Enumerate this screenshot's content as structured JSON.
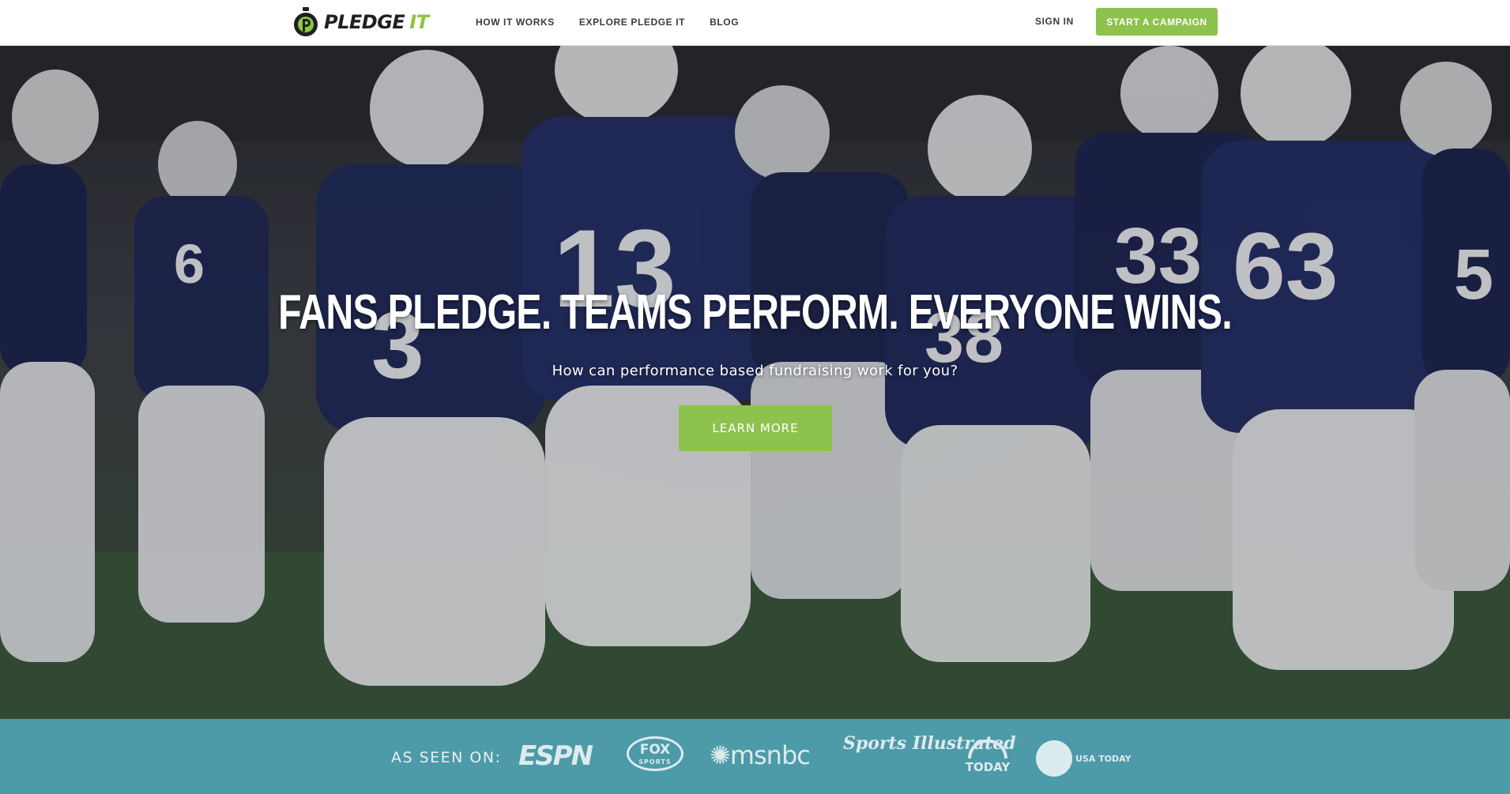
{
  "brand": {
    "name_primary": "PLEDGE",
    "name_accent": "IT",
    "accent_color": "#8dc24d"
  },
  "nav": {
    "items": [
      {
        "label": "HOW IT WORKS"
      },
      {
        "label": "EXPLORE PLEDGE IT"
      },
      {
        "label": "BLOG"
      }
    ],
    "sign_in": "SIGN IN",
    "cta": "START A CAMPAIGN"
  },
  "hero": {
    "headline": "FANS PLEDGE. TEAMS PERFORM. EVERYONE WINS.",
    "subheadline": "How can performance based fundraising work for you?",
    "button": "LEARN MORE"
  },
  "jersey_numbers": [
    "13",
    "3",
    "63",
    "33",
    "38",
    "6",
    "5"
  ],
  "press": {
    "label": "AS SEEN ON:",
    "logos": [
      {
        "name": "espn-logo",
        "text": "ESPN"
      },
      {
        "name": "fox-sports-logo",
        "text": "FOX",
        "sub": "SPORTS"
      },
      {
        "name": "msnbc-logo",
        "text": "msnbc"
      },
      {
        "name": "sports-illustrated-logo",
        "text": "Sports Illustrated"
      },
      {
        "name": "today-logo",
        "text": "TODAY"
      },
      {
        "name": "usa-today-logo",
        "text": "USA TODAY"
      }
    ]
  }
}
